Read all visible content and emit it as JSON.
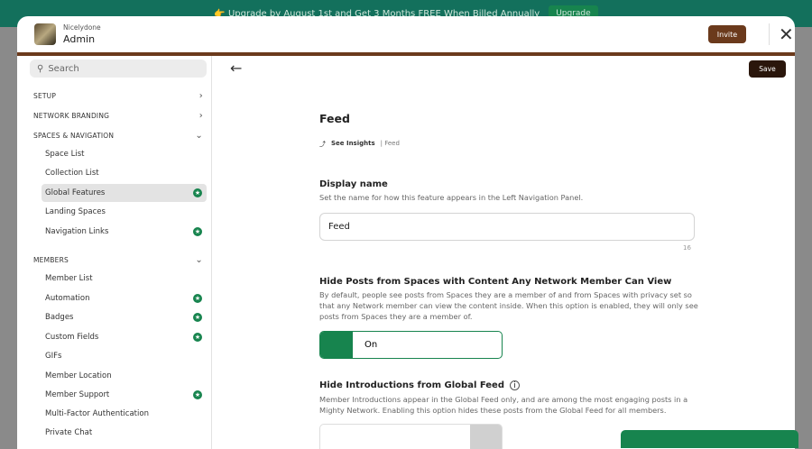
{
  "banner": {
    "text": "👉 Upgrade by August 1st and Get 3 Months FREE When Billed Annually",
    "button": "Upgrade"
  },
  "header": {
    "network": "Nicelydone",
    "title": "Admin",
    "invite": "Invite"
  },
  "search": {
    "placeholder": "Search"
  },
  "sidebar": {
    "sections": [
      "SETUP",
      "NETWORK BRANDING",
      "SPACES & NAVIGATION",
      "MEMBERS"
    ],
    "items": [
      {
        "label": "Space List"
      },
      {
        "label": "Collection List"
      },
      {
        "label": "Global Features"
      },
      {
        "label": "Landing Spaces"
      },
      {
        "label": "Navigation Links"
      },
      {
        "label": "Member List"
      },
      {
        "label": "Automation"
      },
      {
        "label": "Badges"
      },
      {
        "label": "Custom Fields"
      },
      {
        "label": "GIFs"
      },
      {
        "label": "Member Location"
      },
      {
        "label": "Member Support"
      },
      {
        "label": "Multi-Factor Authentication"
      },
      {
        "label": "Private Chat"
      }
    ]
  },
  "toolbar": {
    "save": "Save"
  },
  "main": {
    "title": "Feed",
    "insights": "See Insights",
    "insights_sep": "| Feed",
    "display_name": {
      "label": "Display name",
      "desc": "Set the name for how this feature appears in the Left Navigation Panel.",
      "value": "Feed",
      "count": "16"
    },
    "hide_posts": {
      "label": "Hide Posts from Spaces with Content Any Network Member Can View",
      "desc": "By default, people see posts from Spaces they are a member of and from Spaces with privacy set so that any Network member can view the content inside. When this option is enabled, they will only see posts from Spaces they are a member of.",
      "state": "On"
    },
    "hide_intros": {
      "label": "Hide Introductions from Global Feed",
      "desc": "Member Introductions appear in the Global Feed only, and are among the most engaging posts in a Mighty Network. Enabling this option hides these posts from the Global Feed for all members."
    }
  }
}
